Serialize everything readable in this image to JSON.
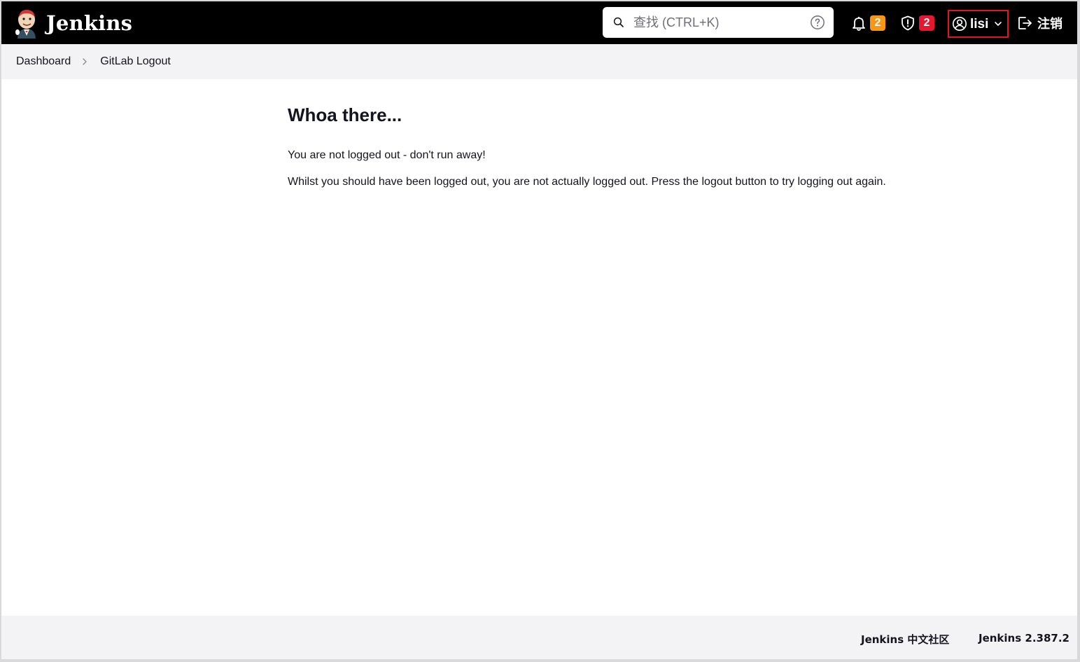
{
  "header": {
    "brand_name": "Jenkins",
    "search": {
      "placeholder": "查找 (CTRL+K)",
      "value": ""
    },
    "notifications": {
      "count": "2",
      "color": "#f99614"
    },
    "security": {
      "count": "2",
      "color": "#e6172e"
    },
    "user": {
      "name": "lisi"
    },
    "logout_label": "注销"
  },
  "breadcrumb": {
    "items": [
      {
        "label": "Dashboard"
      },
      {
        "label": "GitLab Logout"
      }
    ]
  },
  "main": {
    "title": "Whoa there...",
    "line1": "You are not logged out - don't run away!",
    "line2": "Whilst you should have been logged out, you are not actually logged out. Press the logout button to try logging out again."
  },
  "footer": {
    "community_link": "Jenkins 中文社区",
    "version_link": "Jenkins 2.387.2"
  },
  "colors": {
    "header_bg": "#000000",
    "highlight_border": "#e5151d",
    "breadcrumb_bg": "#f3f3f5"
  }
}
